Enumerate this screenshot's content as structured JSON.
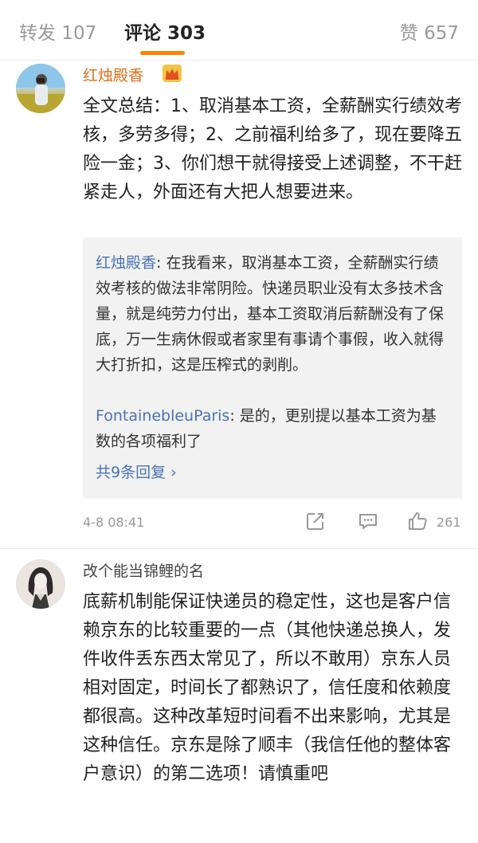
{
  "tabs": {
    "repost": "转发 107",
    "comments": "评论 303",
    "likes": "赞 657"
  },
  "comments": [
    {
      "username": "红烛殿香",
      "text": "全文总结：1、取消基本工资，全薪酬实行绩效考核，多劳多得；2、之前福利给多了，现在要降五险一金；3、你们想干就得接受上述调整，不干赶紧走人，外面还有大把人想要进来。",
      "replies": [
        {
          "name": "红烛殿香",
          "text": ": 在我看来，取消基本工资，全薪酬实行绩效考核的做法非常阴险。快递员职业没有太多技术含量，就是纯劳力付出，基本工资取消后薪酬没有了保底，万一生病休假或者家里有事请个事假，收入就得大打折扣，这是压榨式的剥削。"
        },
        {
          "name": "FontainebleuParis",
          "text": ": 是的，更别提以基本工资为基数的各项福利了"
        }
      ],
      "more_replies": "共9条回复 ›",
      "timestamp": "4-8 08:41",
      "like_count": "261"
    },
    {
      "username": "改个能当锦鲤的名",
      "text": "底薪机制能保证快递员的稳定性，这也是客户信赖京东的比较重要的一点（其他快递总换人，发件收件丢东西太常见了，所以不敢用）京东人员相对固定，时间长了都熟识了，信任度和依赖度都很高。这种改革短时间看不出来影响，尤其是这种信任。京东是除了顺丰（我信任他的整体客户意识）的第二选项！请慎重吧"
    }
  ],
  "icons": {
    "share": "share-icon",
    "comment": "comment-icon",
    "like": "thumbs-up-icon",
    "vip": "vip-crown-icon"
  },
  "colors": {
    "accent": "#ff8200",
    "vip_username": "#e06c16",
    "link": "#4a73b8",
    "reply_bg": "#f2f2f2"
  }
}
